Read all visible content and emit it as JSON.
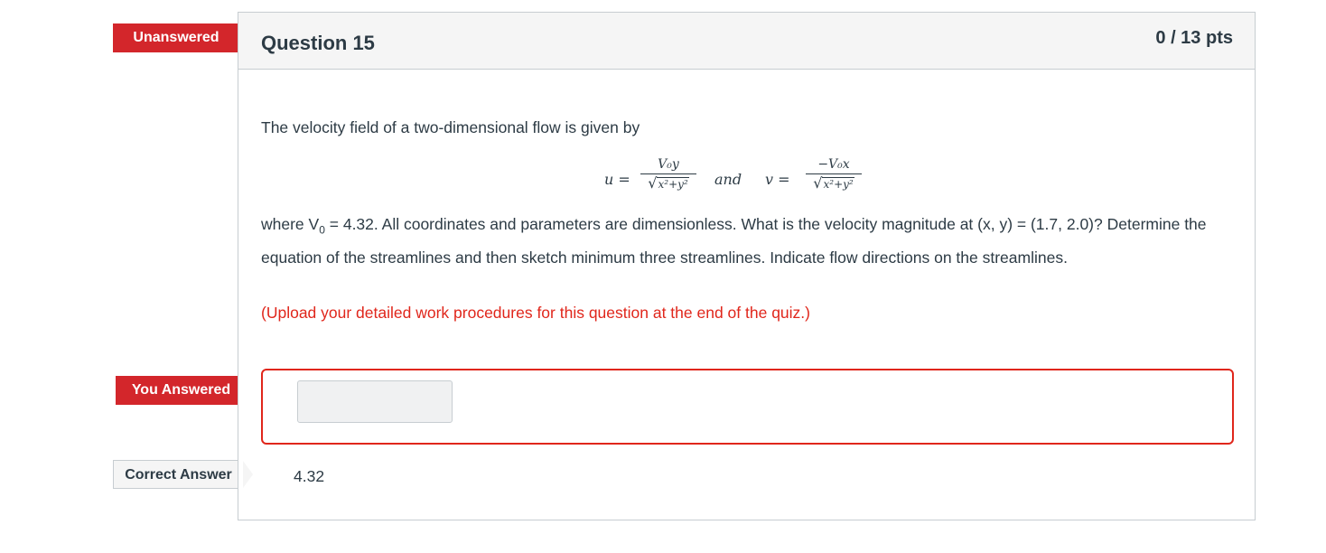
{
  "question": {
    "title": "Question 15",
    "points": "0 / 13 pts",
    "intro": "The velocity field of a two-dimensional flow is given by",
    "formula": {
      "u_lhs": "u =",
      "u_num": "V₀y",
      "u_den": "x²+y²",
      "and": "and",
      "v_lhs": "v =",
      "v_num": "−V₀x",
      "v_den": "x²+y²",
      "radical": "√"
    },
    "description_pre": "where V",
    "description_sub": "0",
    "description_post": " = 4.32. All coordinates and parameters are dimensionless. What is the velocity magnitude at (x, y) = (1.7, 2.0)? Determine the equation of the streamlines and then sketch minimum three streamlines. Indicate flow directions on the streamlines.",
    "upload_note": "(Upload your detailed work procedures for this question at the end of the quiz.)"
  },
  "answer": {
    "input_value": "",
    "correct_value": "4.32"
  },
  "tags": {
    "unanswered": "Unanswered",
    "you_answered": "You Answered",
    "correct_answer": "Correct Answer"
  },
  "colors": {
    "accent_red": "#d3262b",
    "note_red": "#e0261b",
    "text": "#2d3b45",
    "border": "#c7cdd1"
  }
}
